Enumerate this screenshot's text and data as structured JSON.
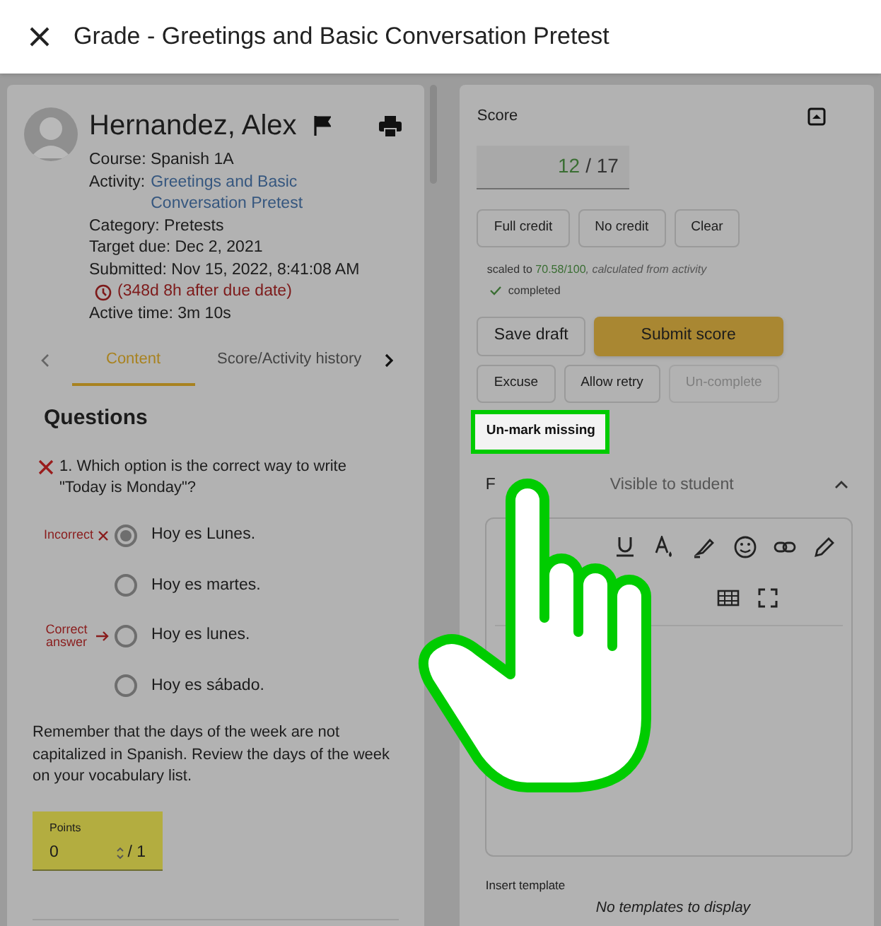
{
  "header": {
    "title": "Grade - Greetings and Basic Conversation Pretest"
  },
  "student": {
    "name": "Hernandez, Alex",
    "details": [
      {
        "kind": "text",
        "text": "Course: Spanish 1A"
      },
      {
        "kind": "link",
        "label": "Activity:",
        "link": "Greetings and Basic Conversation Pretest"
      },
      {
        "kind": "text",
        "text": "Category: Pretests"
      },
      {
        "kind": "text",
        "text": "Target due: Dec 2, 2021"
      },
      {
        "kind": "text",
        "text": "Submitted: Nov 15, 2022, 8:41:08 AM"
      },
      {
        "kind": "late",
        "text": "(348d 8h after due date)"
      },
      {
        "kind": "text",
        "text": "Active time:  3m 10s"
      }
    ]
  },
  "tabs": [
    {
      "label": "Content",
      "selected": true
    },
    {
      "label": "Score/Activity history",
      "selected": false
    }
  ],
  "questions": {
    "title": "Questions",
    "question": {
      "text": "1. Which option is the correct way to write \"Today is Monday\"?",
      "correct": false,
      "options": [
        {
          "text": "Hoy es Lunes.",
          "selected": true,
          "marker": "Incorrect",
          "kind": "incorrect"
        },
        {
          "text": "Hoy es martes.",
          "selected": false
        },
        {
          "text": "Hoy es lunes.",
          "selected": false,
          "marker": "Correct answer",
          "kind": "correct"
        },
        {
          "text": "Hoy es sábado.",
          "selected": false
        }
      ],
      "feedback": "Remember that the days of the week are not capitalized in Spanish. Review the days of the week on your vocabulary list.",
      "points": {
        "label": "Points",
        "value": "0",
        "max": "/ 1"
      }
    }
  },
  "score": {
    "title": "Score",
    "earned": "12",
    "total": "/ 17",
    "credit_buttons": [
      "Full credit",
      "No credit",
      "Clear"
    ],
    "scaled_prefix": "scaled to",
    "scaled_value": "70.58/100",
    "scaled_suffix": ", calculated from activity",
    "status": "completed",
    "actions": [
      {
        "label": "Save draft",
        "kind": "secondary"
      },
      {
        "label": "Submit score",
        "kind": "primary"
      }
    ],
    "more_actions": [
      {
        "label": "Excuse",
        "disabled": false
      },
      {
        "label": "Allow retry",
        "disabled": false
      },
      {
        "label": "Un-complete",
        "disabled": true
      }
    ],
    "highlighted_action": "Un-mark missing"
  },
  "feedback": {
    "tabs": [
      {
        "label": "F",
        "selected": true
      },
      {
        "label": "Visible to student",
        "selected": false
      }
    ],
    "insert_template": "Insert template",
    "empty": "No templates to display"
  }
}
